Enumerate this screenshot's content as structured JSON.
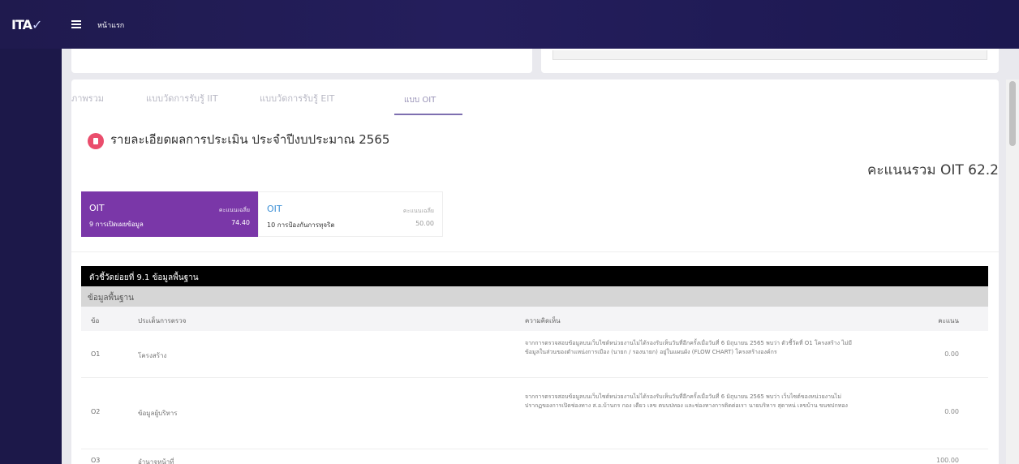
{
  "app": {
    "logo": "ITA",
    "logo_mark": "✓",
    "breadcrumb": "หน้าแรก"
  },
  "tabs": [
    {
      "label": "ภาพรวม"
    },
    {
      "label": "แบบวัดการรับรู้ IIT"
    },
    {
      "label": "แบบวัดการรับรู้ EIT"
    },
    {
      "label": "แบบ OIT"
    }
  ],
  "heading": "รายละเอียดผลการประเมิน ประจำปีงบประมาณ 2565",
  "total": {
    "label": "คะแนนรวม OIT 62.2"
  },
  "score_boxes": [
    {
      "code": "OIT",
      "name": "9 การเปิดเผยข้อมูล",
      "label": "คะแนนเฉลี่ย",
      "value": "74.40"
    },
    {
      "code": "OIT",
      "name": "10 การป้องกันการทุจริต",
      "label": "คะแนนเฉลี่ย",
      "value": "50.00"
    }
  ],
  "table": {
    "title": "ตัวชี้วัดย่อยที่ 9.1 ข้อมูลพื้นฐาน",
    "subtitle": "ข้อมูลพื้นฐาน",
    "headers": {
      "no": "ข้อ",
      "issue": "ประเด็นการตรวจ",
      "comment": "ความคิดเห็น",
      "score": "คะแนน"
    },
    "rows": [
      {
        "no": "O1",
        "issue": "โครงสร้าง",
        "comment": "จากการตรวจสอบข้อมูลบนเว็บไซต์หน่วยงานไม่ได้รองรับเห็นวันที่อีกครั้งเมื่อวันที่ 6 มิถุนายน 2565 พบว่า ตัวชี้วัดที่ O1 โครงสร้าง ไม่มีข้อมูลในส่วนของตำแหน่งการเมือง (นายก / รองนายก) อยู่ในแผนผัง (FLOW CHART) โครงสร้างองค์กร",
        "score": "0.00"
      },
      {
        "no": "O2",
        "issue": "ข้อมูลผู้บริหาร",
        "comment": "จากการตรวจสอบข้อมูลบนเว็บไซต์หน่วยงานไม่ได้รองรับเห็นวันที่อีกครั้งเมื่อวันที่ 6 มิถุนายน 2565 พบว่า เว็บไซต์ของหน่วยงานไม่ปรากฏของการเปิดช่องทาง ส.อ.บ้านกร กอง เดียว เลข ตบบปทอง และช่องทางการติดต่อเรา นายบริหาร สุดาหน่ เลขบ้าน ขนชปกทอง",
        "score": "0.00"
      },
      {
        "no": "O3",
        "issue": "อำนาจหน้าที่",
        "comment": "",
        "score": "100.00"
      }
    ]
  }
}
